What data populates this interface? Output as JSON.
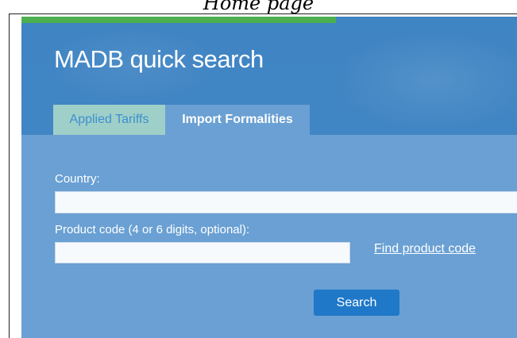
{
  "caption": "Home page",
  "header": {
    "title": "MADB quick search",
    "accent_color": "#4caf50"
  },
  "tabs": [
    {
      "label": "Applied Tariffs",
      "active": false
    },
    {
      "label": "Import Formalities",
      "active": true
    }
  ],
  "form": {
    "country_label": "Country:",
    "country_value": "",
    "product_label": "Product code (4 or 6 digits, optional):",
    "product_value": "",
    "find_link": "Find product code",
    "search_button": "Search"
  },
  "colors": {
    "panel_bg": "#4589c6",
    "form_bg": "#6aa0d3",
    "button_bg": "#1f78c8",
    "inactive_tab_bg": "#9fcfc9"
  }
}
